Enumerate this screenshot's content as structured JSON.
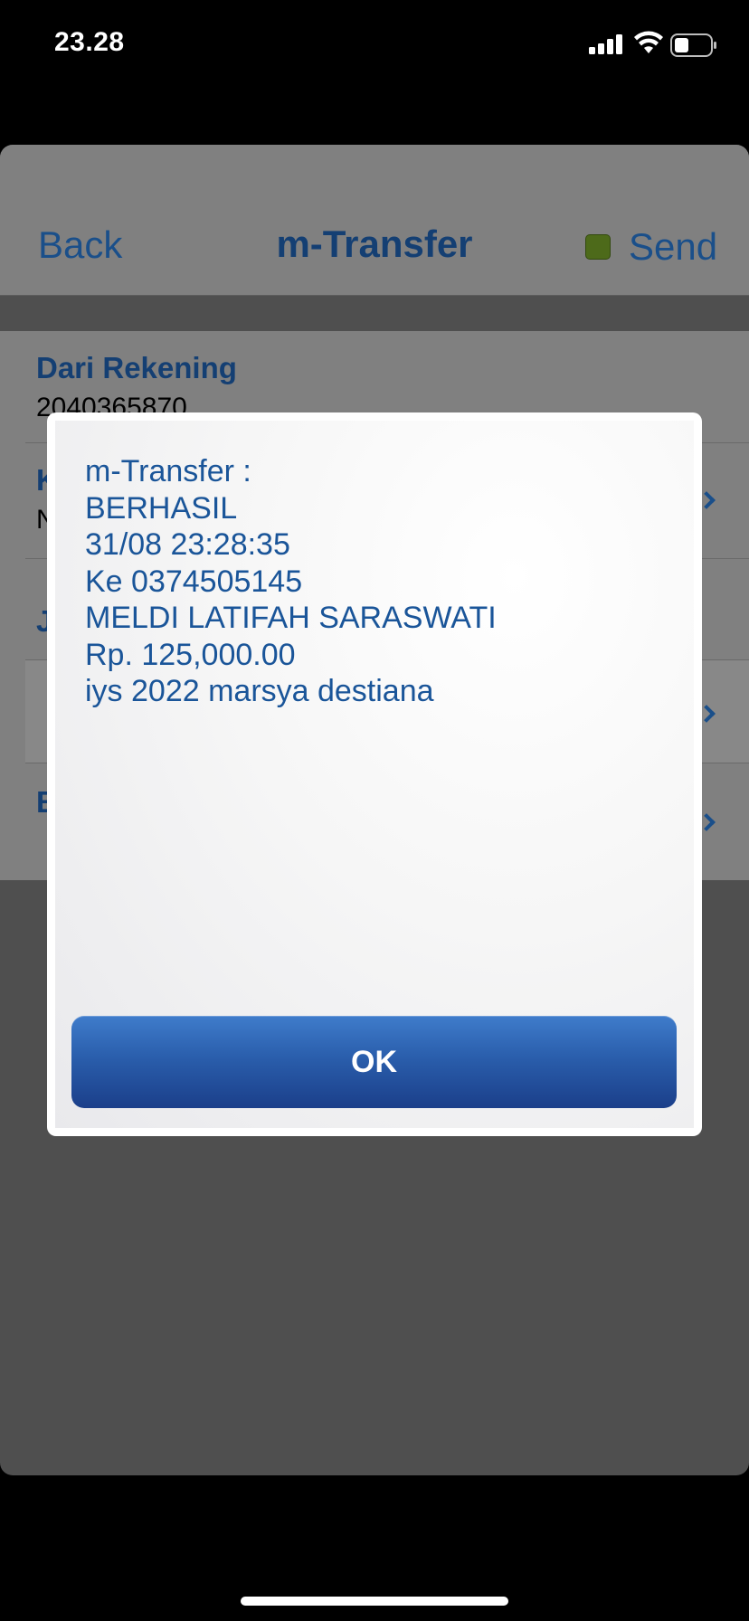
{
  "status_bar": {
    "time": "23.28"
  },
  "navbar": {
    "back_label": "Back",
    "title": "m-Transfer",
    "send_label": "Send"
  },
  "form": {
    "rows": [
      {
        "label": "Dari Rekening",
        "value": "2040365870"
      },
      {
        "label": "K",
        "value": "N"
      },
      {
        "label": "J",
        "value": ""
      },
      {
        "label": "",
        "value": ""
      },
      {
        "label": "B",
        "value": ""
      }
    ]
  },
  "dialog": {
    "lines": [
      "m-Transfer :",
      "BERHASIL",
      "31/08 23:28:35",
      "Ke 0374505145",
      "MELDI LATIFAH SARASWATI",
      "Rp. 125,000.00",
      "iys 2022 marsya destiana"
    ],
    "ok_label": "OK"
  },
  "colors": {
    "accent": "#1a4f8a",
    "button_blue": "#2a5eac",
    "send_indicator": "#4d6a1a"
  }
}
